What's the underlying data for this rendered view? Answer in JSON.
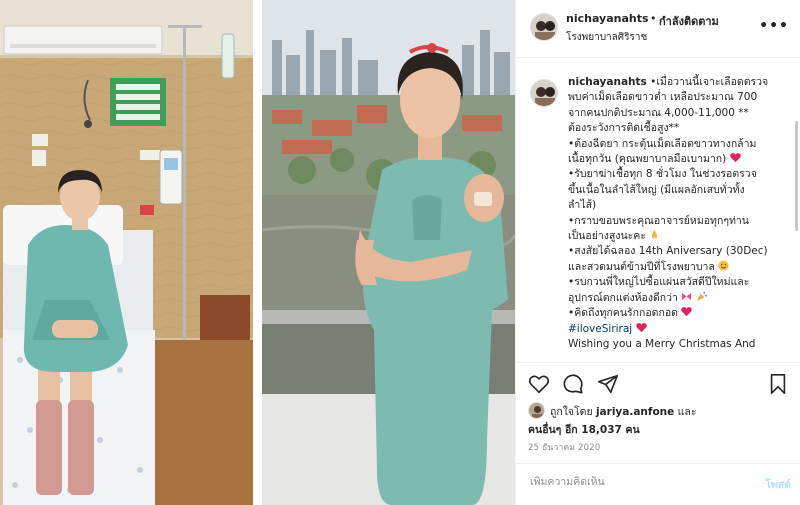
{
  "header": {
    "username": "nichayanahts",
    "separator": "•",
    "follow_status": "กำลังติดตาม",
    "location": "โรงพยาบาลศิริราช",
    "more": "•••"
  },
  "caption": {
    "username": "nichayanahts",
    "lines": [
      "•เมื่อวานนี้เจาะเลือดตรวจ",
      "พบค่าเม็ดเลือดขาวต่ำ เหลือประมาณ 700",
      "จากคนปกติประมาณ 4,000-11,000 **",
      "ต้องระวังการติดเชื้อสูง**",
      "•ต้องฉีดยา กระตุ้นเม็ดเลือดขาวทางกล้าม",
      "เนื้อทุกวัน (คุณพยาบาลมือเบามาก)",
      "•รับยาฆ่าเชื้อทุก 8 ชั่วโมง ในช่วงรอตรวจ",
      "ขึ้นเนื้อในลำไส้ใหญ่ (มีแผลอักเสบทั่วทั้ง",
      "ลำไส้)",
      "•กราบขอบพระคุณอาจารย์หมอทุกๆท่าน",
      "เป็นอย่างสูงนะคะ",
      "•สงสัยได้ฉลอง 14th Aniversary (30Dec)",
      "และสวดมนต์ข้ามปีที่โรงพยาบาล",
      "•รบกวนพี่ใหญ่ไปซื้อแผ่นสวัสดีปีใหม่และ",
      "อุปกรณ์ตกแต่งห้องดีกว่า",
      "•คิดถึงทุกคนรักกอดกอด",
      "#iloveSiriraj",
      "Wishing you a Merry Christmas And"
    ]
  },
  "likes": {
    "prefix": "ถูกใจโดย",
    "first_user": "jariya.anfone",
    "and": "และ",
    "others_label": "คนอื่นๆ อีก 18,037 คน"
  },
  "date": "25 ธันวาคม 2020",
  "comment": {
    "placeholder": "เพิ่มความคิดเห็น",
    "post_label": "โพสต์"
  },
  "colors": {
    "heart": "#e0245e",
    "hashtag": "#00376b",
    "post_button": "#b2dffc",
    "secondary_text": "#8e8e8e"
  },
  "icons": {
    "like": "heart-outline-icon",
    "comment": "speech-bubble-icon",
    "share": "paper-plane-icon",
    "save": "bookmark-icon",
    "more": "ellipsis-icon"
  }
}
